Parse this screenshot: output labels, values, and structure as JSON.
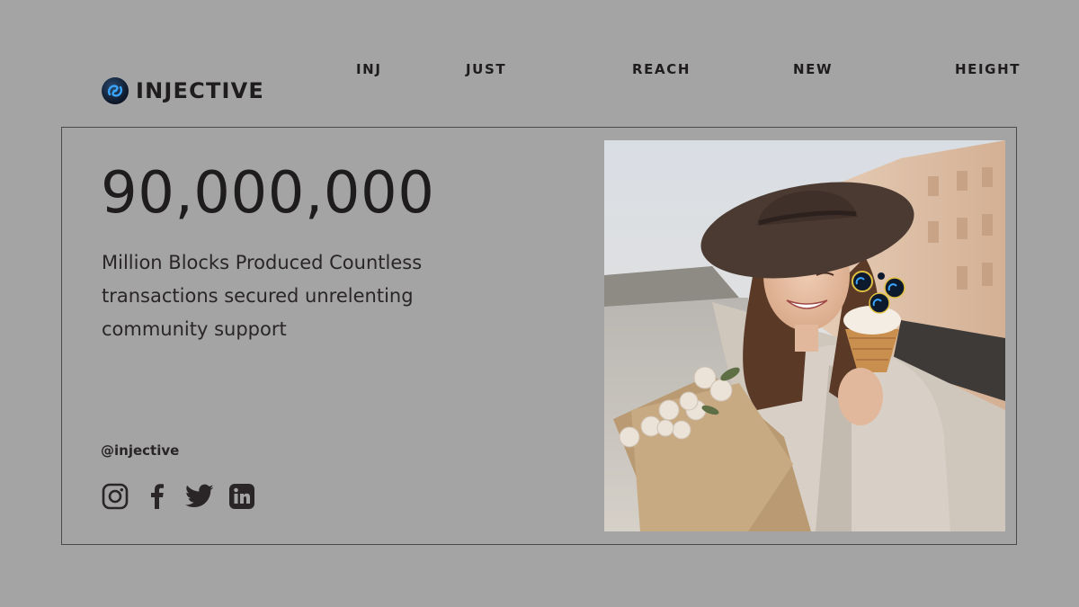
{
  "brand": {
    "name": "INJECTIVE",
    "icon": "injective-logo-icon"
  },
  "nav": {
    "words": [
      "INJ",
      "JUST",
      "REACH",
      "NEW",
      "HEIGHT"
    ]
  },
  "headline": {
    "number": "90,000,000"
  },
  "description": "Million Blocks Produced Countless transactions secured unrelenting community support",
  "social": {
    "handle": "@injective",
    "icons": [
      "instagram-icon",
      "facebook-icon",
      "twitter-icon",
      "linkedin-icon"
    ]
  },
  "photo": {
    "subject": "woman-with-hat-flowers-ice-cream"
  },
  "colors": {
    "background": "#a4a4a4",
    "text": "#1f1c1e",
    "accent": "#2d9bf0"
  }
}
